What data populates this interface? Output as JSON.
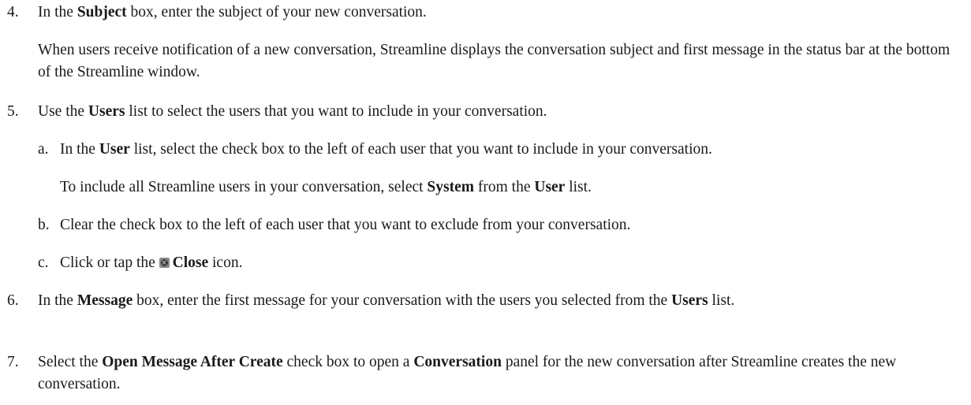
{
  "steps": [
    {
      "number": "4.",
      "line": [
        "In the ",
        "Subject",
        " box, enter the subject of your new conversation."
      ],
      "note": "When users receive notification of a new conversation, Streamline displays the conversation subject and first message in the status bar at the bottom of the Streamline window."
    },
    {
      "number": "5.",
      "line": [
        "Use the ",
        "Users",
        " list to select the users that you want to include in your conversation."
      ],
      "substeps": [
        {
          "letter": "a.",
          "line": [
            "In the ",
            "User",
            " list, select the check box to the left of each user that you want to include in your conversation."
          ],
          "note": [
            "To include all Streamline users in your conversation, select ",
            "System",
            " from the ",
            "User",
            " list."
          ]
        },
        {
          "letter": "b.",
          "text": "Clear the check box to the left of each user that you want to exclude from your conversation."
        },
        {
          "letter": "c.",
          "line": [
            "Click or tap the ",
            "Close",
            " icon."
          ],
          "icon": "close-icon"
        }
      ]
    },
    {
      "number": "6.",
      "line": [
        "In the ",
        "Message",
        " box, enter the first message for your conversation with the users you selected from the ",
        "Users",
        " list."
      ]
    },
    {
      "number": "7.",
      "line": [
        "Select the ",
        "Open Message After Create",
        " check box to open a ",
        "Conversation",
        " panel for the new conversation after Streamline creates the new conversation."
      ]
    }
  ]
}
